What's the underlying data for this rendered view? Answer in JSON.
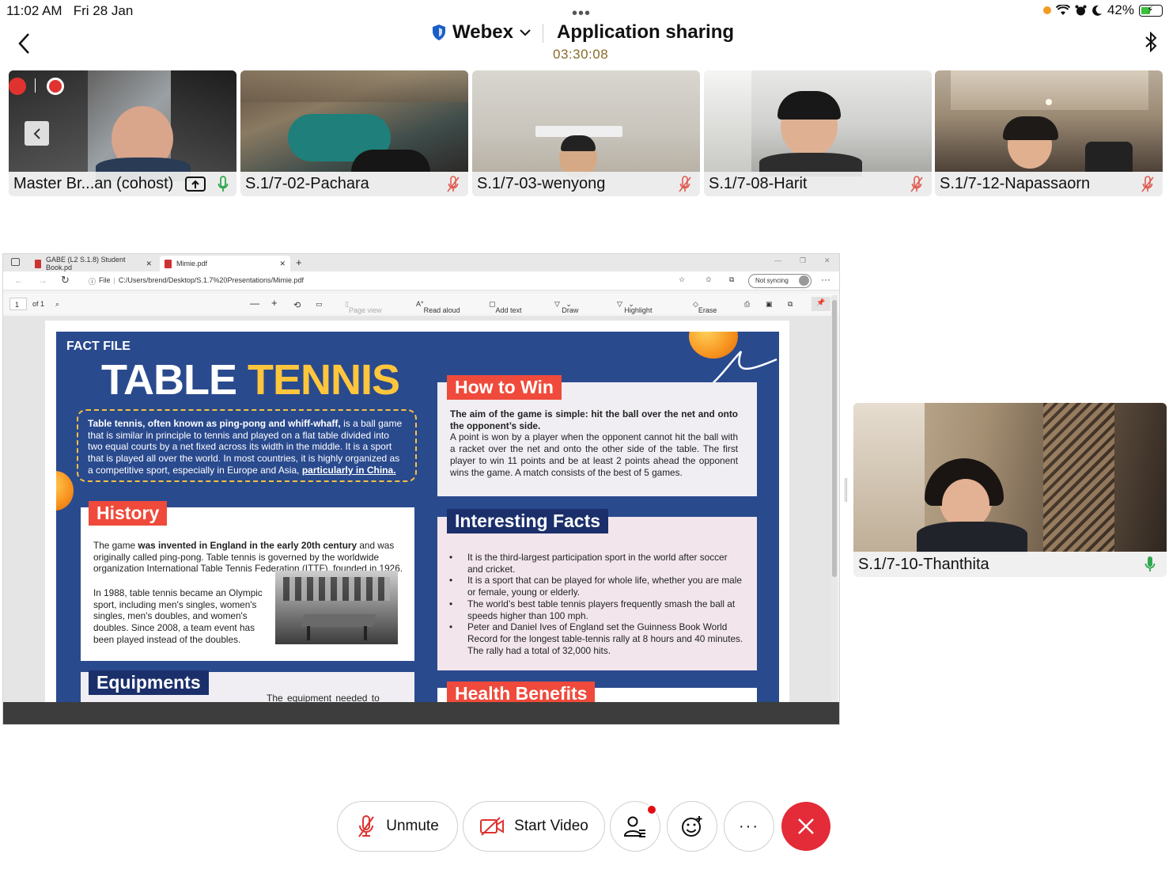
{
  "status_bar": {
    "time": "11:02 AM",
    "date": "Fri 28 Jan",
    "battery": "42%"
  },
  "header": {
    "app_name": "Webex",
    "title": "Application sharing",
    "timer": "03:30:08"
  },
  "participants": [
    {
      "name": "Master Br...an (cohost)",
      "mic": "on"
    },
    {
      "name": "S.1/7-02-Pachara",
      "mic": "muted"
    },
    {
      "name": "S.1/7-03-wenyong",
      "mic": "muted"
    },
    {
      "name": "S.1/7-08-Harit",
      "mic": "muted"
    },
    {
      "name": "S.1/7-12-Napassaorn",
      "mic": "muted"
    }
  ],
  "active_speaker": {
    "name": "S.1/7-10-Thanthita",
    "mic": "on"
  },
  "browser": {
    "tabs": [
      {
        "title": "GABE (L2 S.1.8) Student Book.pd"
      },
      {
        "title": "Mimie.pdf"
      }
    ],
    "address": {
      "scheme": "File",
      "path": "C:/Users/brend/Desktop/S.1.7%20Presentations/Mimie.pdf"
    },
    "sync_label": "Not syncing",
    "pdf_toolbar": {
      "page": "1",
      "page_of": "of 1",
      "page_view": "Page view",
      "read_aloud": "Read aloud",
      "add_text": "Add text",
      "draw": "Draw",
      "highlight": "Highlight",
      "erase": "Erase"
    }
  },
  "poster": {
    "label": "FACT FILE",
    "title_white": "TABLE",
    "title_yellow": "TENNIS",
    "intro": {
      "bold": "Table tennis, often known as ping-pong and whiff-whaff,",
      "text": " is a ball game that is similar in principle to tennis and played on a flat table divided into two equal courts by a net fixed across its width in the middle. It is a sport that is played all over the world. In most countries, it is highly organized as a competitive sport, especially in Europe and Asia, ",
      "link": "particularly in China."
    },
    "how_to_win": {
      "heading": "How to Win",
      "bold": "The aim of the game is simple: hit the ball over the net and onto the opponent’s side.",
      "text": "A point is won by a player when the opponent cannot hit the ball with a racket over the net and onto the other side of the table. The first player to win 11 points and be at least 2 points ahead the opponent wins the game. A match consists of the best of 5 games."
    },
    "history": {
      "heading": "History",
      "p1_start": "The game ",
      "p1_bold": "was invented in England in the early 20th century",
      "p1_end": " and was originally called ping-pong. Table tennis is governed by the worldwide organization International Table Tennis Federation (ITTF), founded in 1926.",
      "p2": "In 1988, table tennis became an Olympic sport, including men's singles, women's singles, men's doubles, and women's doubles. Since 2008, a team event has been played instead of the doubles."
    },
    "interesting_facts": {
      "heading": "Interesting Facts",
      "items": [
        "It is the third-largest participation sport in the world after soccer and cricket.",
        "It is a sport that can be played for whole life, whether you are male or female, young or elderly.",
        "The world’s best table tennis players frequently smash the ball at speeds higher than 100 mph.",
        "Peter and Daniel Ives of England set the Guinness Book World Record for the longest table-tennis rally at 8 hours and 40 minutes. The rally had a total of 32,000 hits."
      ]
    },
    "equipments": {
      "heading": "Equipments",
      "text": "The   equipment   needed   to"
    },
    "health": {
      "heading": "Health Benefits"
    }
  },
  "controls": {
    "unmute": "Unmute",
    "start_video": "Start Video"
  },
  "colors": {
    "poster_bg": "#2a4a8e",
    "accent_red": "#ef4a3b",
    "end_call": "#e42b38",
    "title_yellow": "#ffc63d"
  }
}
